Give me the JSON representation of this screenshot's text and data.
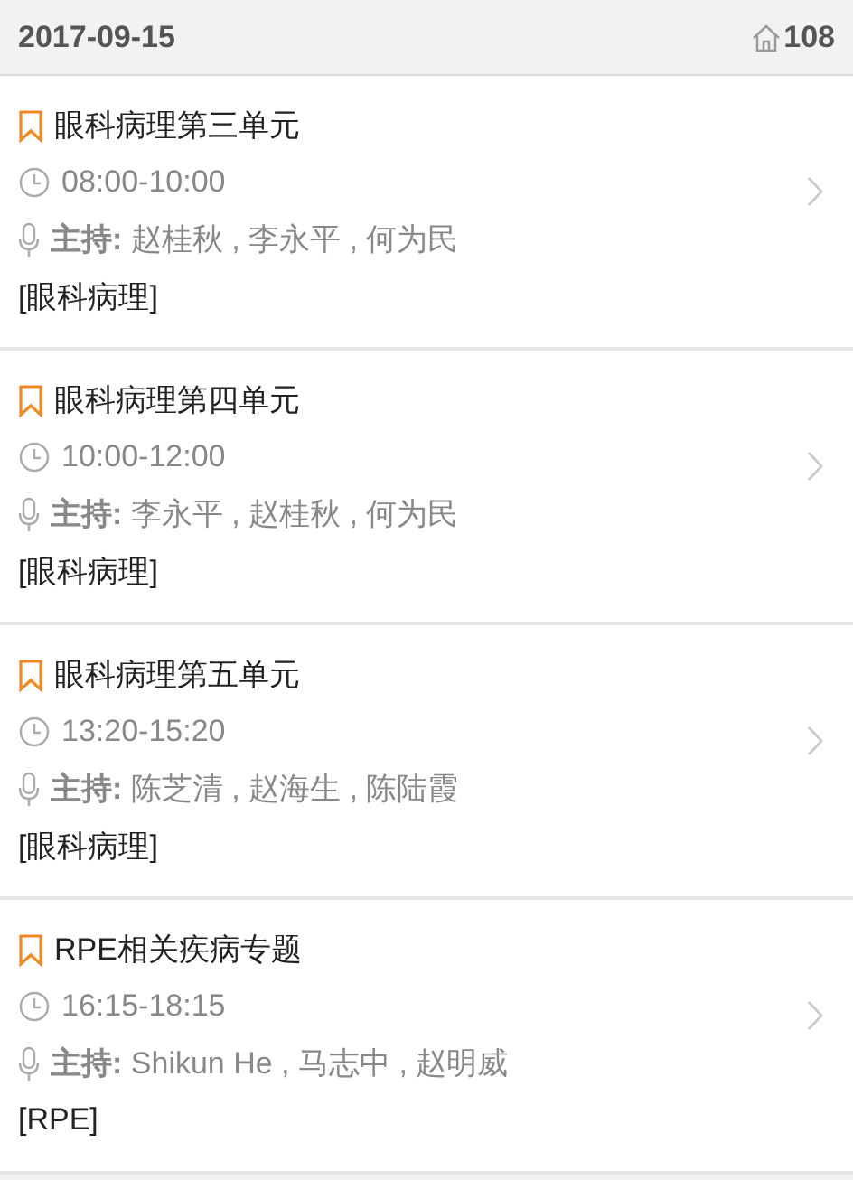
{
  "header": {
    "date": "2017-09-15",
    "room": "108"
  },
  "sessions": [
    {
      "title": "眼科病理第三单元",
      "time": "08:00-10:00",
      "hosts": "**主持:** 赵桂秋 , 李永平 , 何为民",
      "tag": "[眼科病理]"
    },
    {
      "title": "眼科病理第四单元",
      "time": "10:00-12:00",
      "hosts": "**主持:** 李永平 , 赵桂秋 , 何为民",
      "tag": "[眼科病理]"
    },
    {
      "title": "眼科病理第五单元",
      "time": "13:20-15:20",
      "hosts": "**主持:** 陈芝清 , 赵海生 , 陈陆霞",
      "tag": "[眼科病理]"
    },
    {
      "title": "RPE相关疾病专题",
      "time": "16:15-18:15",
      "hosts": "**主持:** Shikun He , 马志中 , 赵明威",
      "tag": "[RPE]"
    }
  ]
}
